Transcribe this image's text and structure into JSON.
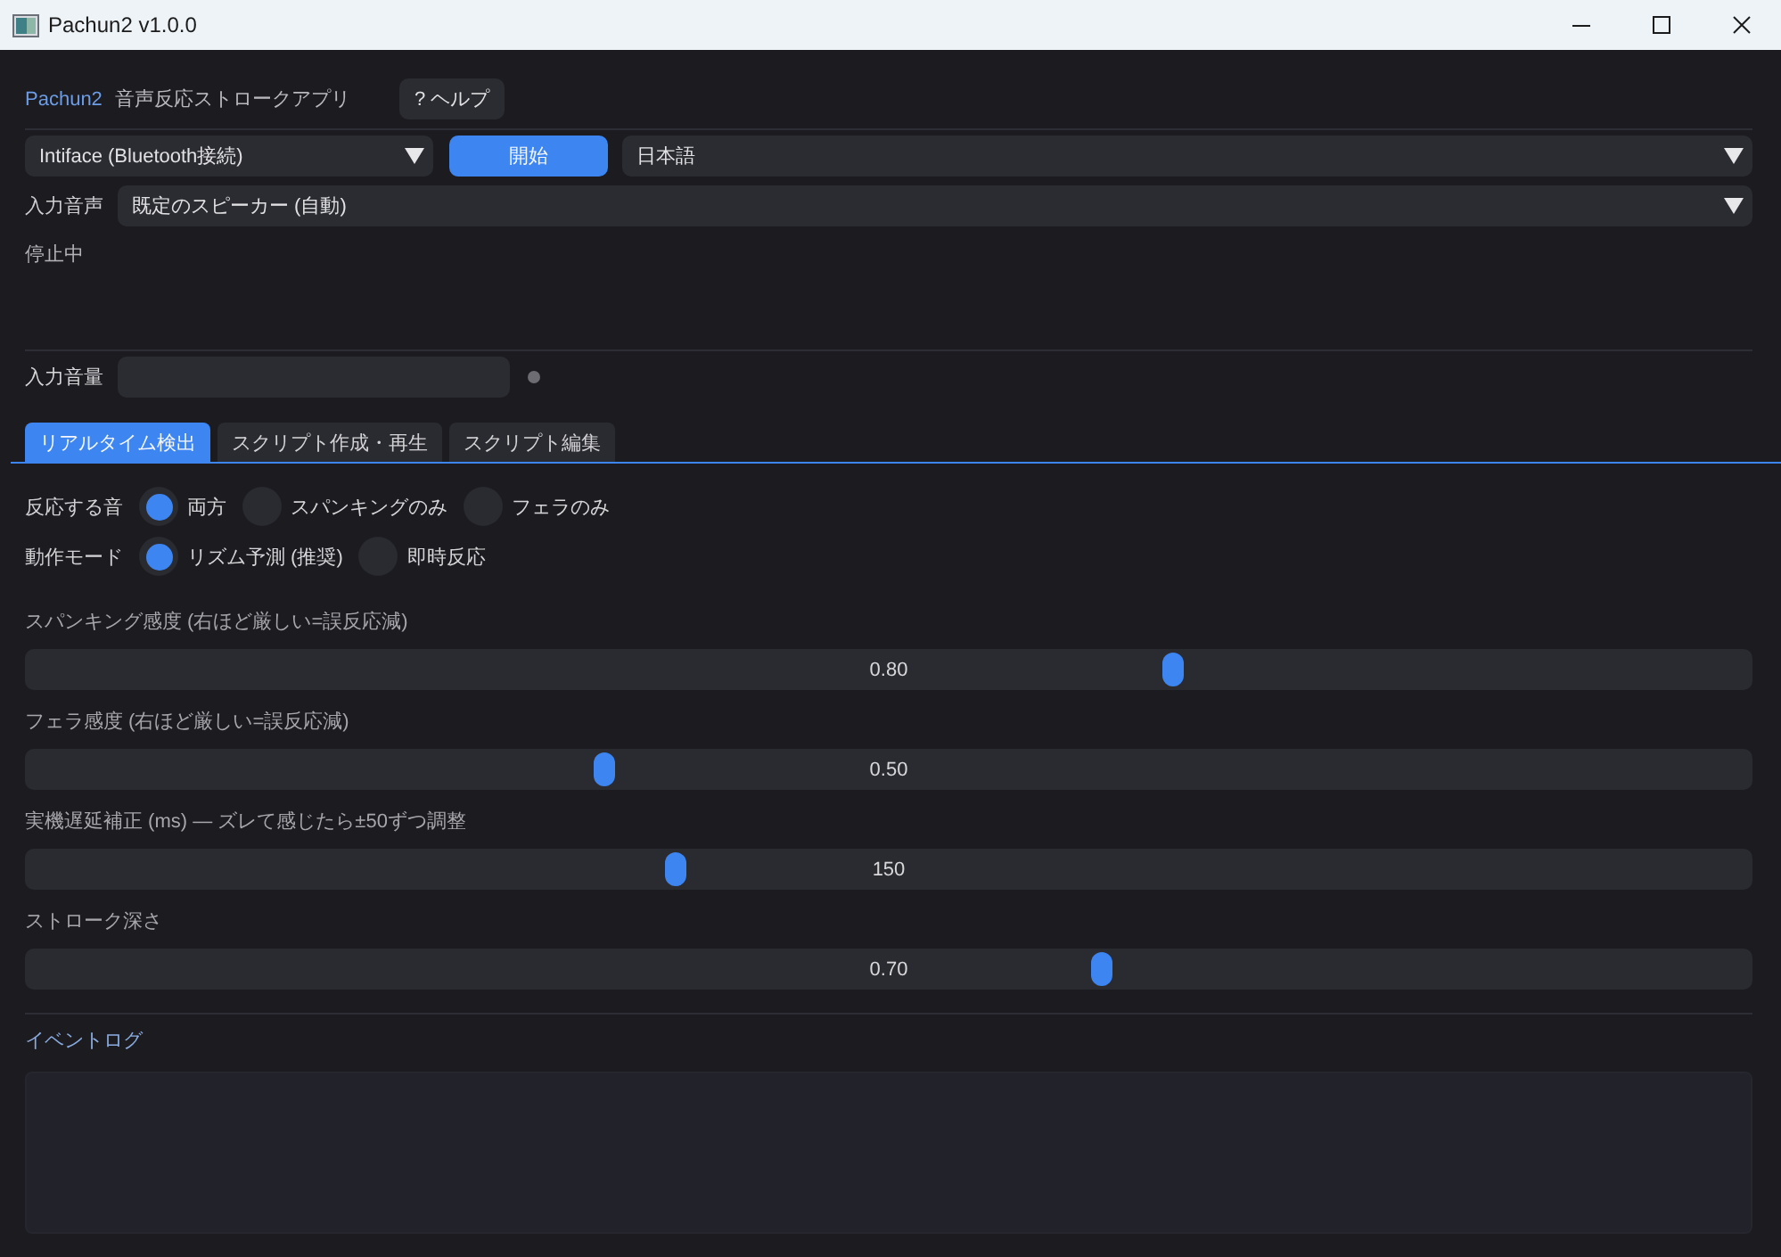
{
  "window": {
    "title": "Pachun2 v1.0.0"
  },
  "header": {
    "app_name": "Pachun2",
    "subtitle": "音声反応ストロークアプリ",
    "help_button": "? ヘルプ"
  },
  "connection": {
    "device": "Intiface (Bluetooth接続)",
    "start_button": "開始",
    "language": "日本語"
  },
  "input_audio": {
    "label": "入力音声",
    "value": "既定のスピーカー (自動)"
  },
  "status": "停止中",
  "input_volume": {
    "label": "入力音量",
    "active": false
  },
  "tabs": [
    {
      "label": "リアルタイム検出",
      "selected": true
    },
    {
      "label": "スクリプト作成・再生",
      "selected": false
    },
    {
      "label": "スクリプト編集",
      "selected": false
    }
  ],
  "radio_groups": [
    {
      "label": "反応する音",
      "options": [
        {
          "label": "両方",
          "selected": true
        },
        {
          "label": "スパンキングのみ",
          "selected": false
        },
        {
          "label": "フェラのみ",
          "selected": false
        }
      ]
    },
    {
      "label": "動作モード",
      "options": [
        {
          "label": "リズム予測 (推奨)",
          "selected": true
        },
        {
          "label": "即時反応",
          "selected": false
        }
      ]
    }
  ],
  "sliders": [
    {
      "label": "スパンキング感度 (右ほど厳しい=誤反応減)",
      "reading": "0.80",
      "level": 0.667
    },
    {
      "label": "フェラ感度 (右ほど厳しい=誤反応減)",
      "reading": "0.50",
      "level": 0.333
    },
    {
      "label": "実機遅延補正 (ms) — ズレて感じたら±50ずつ調整",
      "reading": "150",
      "level": 0.375
    },
    {
      "label": "ストローク深さ",
      "reading": "0.70",
      "level": 0.625
    }
  ],
  "event_log": {
    "label": "イベントログ"
  }
}
